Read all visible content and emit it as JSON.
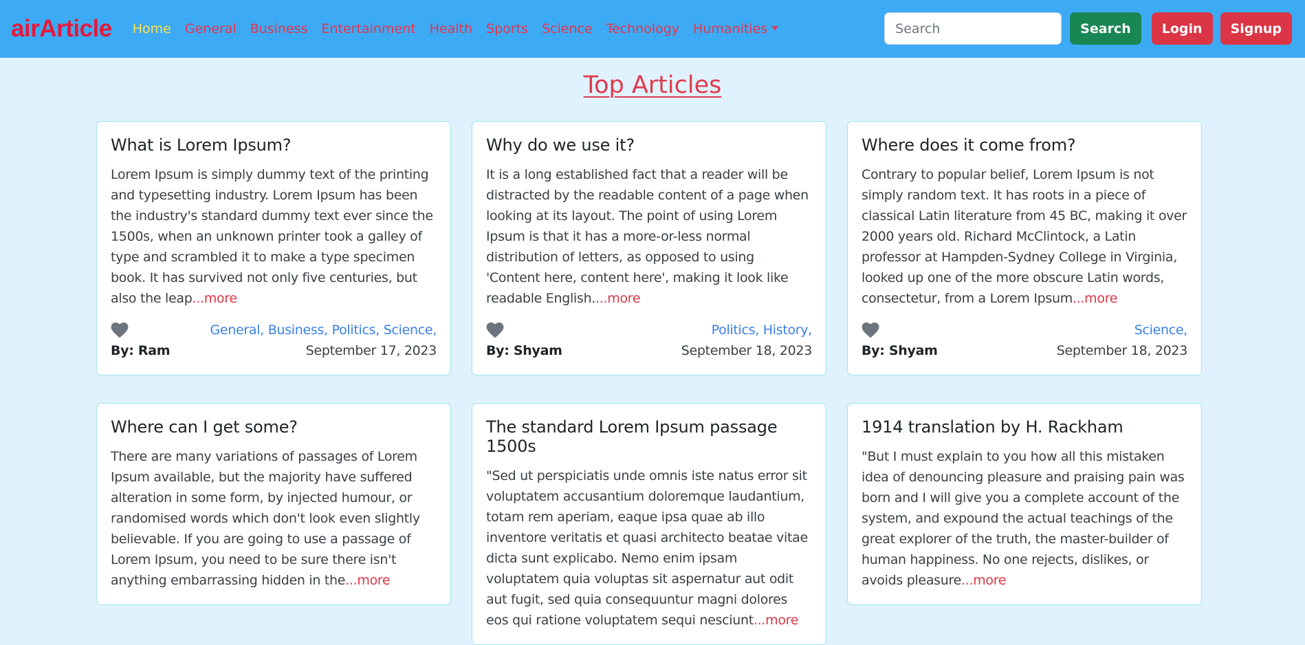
{
  "navbar": {
    "brand": "airArticle",
    "links": [
      {
        "label": "Home",
        "active": true
      },
      {
        "label": "General"
      },
      {
        "label": "Business"
      },
      {
        "label": "Entertainment"
      },
      {
        "label": "Health"
      },
      {
        "label": "Sports"
      },
      {
        "label": "Science"
      },
      {
        "label": "Technology"
      },
      {
        "label": "Humanities",
        "dropdown": true
      }
    ],
    "search_placeholder": "Search",
    "search_button": "Search",
    "login_button": "Login",
    "signup_button": "Signup"
  },
  "heading": "Top Articles",
  "articles": [
    {
      "title": "What is Lorem Ipsum?",
      "text": "Lorem Ipsum is simply dummy text of the printing and typesetting industry. Lorem Ipsum has been the industry's standard dummy text ever since the 1500s, when an unknown printer took a galley of type and scrambled it to make a type specimen book. It has survived not only five centuries, but also the leap",
      "more": "...more",
      "categories": "General, Business, Politics, Science,",
      "author": "By: Ram",
      "date": "September 17, 2023"
    },
    {
      "title": "Why do we use it?",
      "text": "It is a long established fact that a reader will be distracted by the readable content of a page when looking at its layout. The point of using Lorem Ipsum is that it has a more-or-less normal distribution of letters, as opposed to using 'Content here, content here', making it look like readable English.",
      "more": "...more",
      "categories": "Politics, History,",
      "author": "By: Shyam",
      "date": "September 18, 2023"
    },
    {
      "title": "Where does it come from?",
      "text": "Contrary to popular belief, Lorem Ipsum is not simply random text. It has roots in a piece of classical Latin literature from 45 BC, making it over 2000 years old. Richard McClintock, a Latin professor at Hampden-Sydney College in Virginia, looked up one of the more obscure Latin words, consectetur, from a Lorem Ipsum",
      "more": "...more",
      "categories": "Science,",
      "author": "By: Shyam",
      "date": "September 18, 2023"
    },
    {
      "title": "Where can I get some?",
      "text": "There are many variations of passages of Lorem Ipsum available, but the majority have suffered alteration in some form, by injected humour, or randomised words which don't look even slightly believable. If you are going to use a passage of Lorem Ipsum, you need to be sure there isn't anything embarrassing hidden in the",
      "more": "...more"
    },
    {
      "title": "The standard Lorem Ipsum passage 1500s",
      "text": "\"Sed ut perspiciatis unde omnis iste natus error sit voluptatem accusantium doloremque laudantium, totam rem aperiam, eaque ipsa quae ab illo inventore veritatis et quasi architecto beatae vitae dicta sunt explicabo. Nemo enim ipsam voluptatem quia voluptas sit aspernatur aut odit aut fugit, sed quia consequuntur magni dolores eos qui ratione voluptatem sequi nesciunt",
      "more": "...more"
    },
    {
      "title": "1914 translation by H. Rackham",
      "text": "\"But I must explain to you how all this mistaken idea of denouncing pleasure and praising pain was born and I will give you a complete account of the system, and expound the actual teachings of the great explorer of the truth, the master-builder of human happiness. No one rejects, dislikes, or avoids pleasure",
      "more": "...more"
    }
  ],
  "colors": {
    "navbar_bg": "#3daaf5",
    "page_bg": "#e0f2fd",
    "brand": "#e5193a",
    "nav_active": "#ffe14a",
    "accent_red": "#dc3545",
    "success": "#198754",
    "category_blue": "#3a80e6"
  }
}
